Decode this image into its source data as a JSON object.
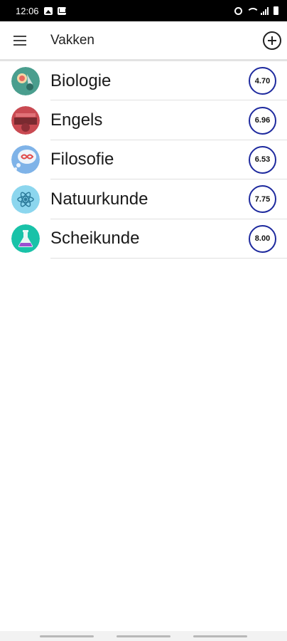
{
  "status_bar": {
    "time": "12:06",
    "left_icons": [
      "image-icon",
      "mail-icon"
    ],
    "right_icons": [
      "alarm-icon",
      "wifi-icon",
      "signal-icon",
      "battery-icon"
    ]
  },
  "app_bar": {
    "title": "Vakken",
    "menu_icon": "hamburger-menu-icon",
    "add_icon": "add-circle-icon"
  },
  "subjects": [
    {
      "name": "Biologie",
      "grade": "4.70",
      "icon": "biology-icon",
      "icon_bg": "#4a9e8e"
    },
    {
      "name": "Engels",
      "grade": "6.96",
      "icon": "english-icon",
      "icon_bg": "#c94a52"
    },
    {
      "name": "Filosofie",
      "grade": "6.53",
      "icon": "philosophy-icon",
      "icon_bg": "#7fb3e8"
    },
    {
      "name": "Natuurkunde",
      "grade": "7.75",
      "icon": "physics-icon",
      "icon_bg": "#8cd6ee"
    },
    {
      "name": "Scheikunde",
      "grade": "8.00",
      "icon": "chemistry-icon",
      "icon_bg": "#19c2a8"
    }
  ],
  "colors": {
    "grade_ring": "#1e2a9e",
    "divider": "#e0e0e0"
  }
}
